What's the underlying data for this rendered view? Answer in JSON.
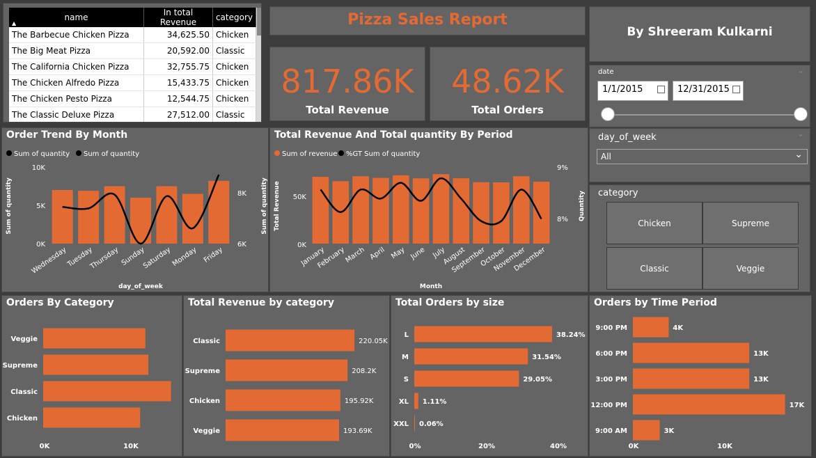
{
  "table": {
    "headers": [
      "name",
      "In total Revenue",
      "category"
    ],
    "rows": [
      [
        "The Barbecue Chicken Pizza",
        "34,625.50",
        "Chicken"
      ],
      [
        "The Big Meat Pizza",
        "20,592.00",
        "Classic"
      ],
      [
        "The California Chicken Pizza",
        "32,755.75",
        "Chicken"
      ],
      [
        "The Chicken Alfredo Pizza",
        "15,433.75",
        "Chicken"
      ],
      [
        "The Chicken Pesto Pizza",
        "12,544.75",
        "Chicken"
      ],
      [
        "The Classic Deluxe Pizza",
        "27,512.00",
        "Classic"
      ]
    ]
  },
  "report_title": "Pizza Sales Report",
  "author": "By Shreeram Kulkarni",
  "kpis": {
    "revenue_value": "817.86K",
    "revenue_label": "Total Revenue",
    "orders_value": "48.62K",
    "orders_label": "Total Orders"
  },
  "date_filter": {
    "label": "date",
    "start": "1/1/2015",
    "end": "12/31/2015"
  },
  "dow_filter": {
    "label": "day_of_week",
    "value": "All"
  },
  "category_filter": {
    "label": "category",
    "options": [
      "Chicken",
      "Supreme",
      "Classic",
      "Veggie"
    ]
  },
  "colors": {
    "bar": "#e46a33",
    "panel": "#646464",
    "title": "#e46a33"
  },
  "chart_data": [
    {
      "type": "bar",
      "title": "Order Trend By Month",
      "legend": [
        "Sum of quantity",
        "Sum of quantity"
      ],
      "xlabel": "day_of_week",
      "ylabel": "Sum of quantity",
      "y2label": "Sum of quantity",
      "categories": [
        "Wednesday",
        "Tuesday",
        "Thursday",
        "Sunday",
        "Saturday",
        "Monday",
        "Friday"
      ],
      "values": [
        7000,
        6900,
        7500,
        6000,
        7500,
        6500,
        8200
      ],
      "line_values": [
        7200,
        7150,
        7600,
        6000,
        7550,
        6500,
        8250
      ],
      "yticks": [
        "10K",
        "5K",
        "0K"
      ],
      "y2ticks": [
        "8K",
        "6K"
      ],
      "ylim": [
        0,
        10000
      ],
      "y2lim": [
        6000,
        8500
      ]
    },
    {
      "type": "bar",
      "title": "Total Revenue And Total quantity By Period",
      "legend": [
        "Sum of revenue",
        "%GT Sum of quantity"
      ],
      "xlabel": "Month",
      "ylabel": "Total Revenue",
      "y2label": "Quantity",
      "categories": [
        "January",
        "February",
        "March",
        "April",
        "May",
        "June",
        "July",
        "August",
        "September",
        "October",
        "November",
        "December"
      ],
      "values": [
        69800,
        65200,
        70400,
        68700,
        71400,
        68200,
        72600,
        68300,
        64200,
        64000,
        70400,
        64700
      ],
      "line_values": [
        8.6,
        8.1,
        8.6,
        8.4,
        8.75,
        8.35,
        8.85,
        8.4,
        7.9,
        7.9,
        8.6,
        7.95
      ],
      "yticks": [
        "50K",
        "0K"
      ],
      "y2ticks": [
        "9%",
        "8%"
      ],
      "ylim": [
        0,
        80000
      ],
      "y2lim": [
        7.4,
        9.1
      ]
    },
    {
      "type": "bar",
      "title": "Orders By Category",
      "categories": [
        "Veggie",
        "Supreme",
        "Classic",
        "Chicken"
      ],
      "values": [
        11650,
        11990,
        14580,
        11050
      ],
      "xticks": [
        "0K",
        "10K"
      ],
      "xlim": [
        0,
        15000
      ]
    },
    {
      "type": "bar",
      "title": "Total Revenue by category",
      "categories": [
        "Classic",
        "Supreme",
        "Chicken",
        "Veggie"
      ],
      "values": [
        220050,
        208200,
        195920,
        193690
      ],
      "labels": [
        "220.05K",
        "208.2K",
        "195.92K",
        "193.69K"
      ]
    },
    {
      "type": "bar",
      "title": "Total Orders by size",
      "categories": [
        "L",
        "M",
        "S",
        "XL",
        "XXL"
      ],
      "values": [
        38.24,
        31.54,
        29.05,
        1.11,
        0.06
      ],
      "labels": [
        "38.24%",
        "31.54%",
        "29.05%",
        "1.11%",
        "0.06%"
      ],
      "xticks": [
        "0%",
        "20%",
        "40%"
      ],
      "xlim": [
        0,
        40
      ]
    },
    {
      "type": "bar",
      "title": "Orders by Time Period",
      "categories": [
        "9:00 PM",
        "6:00 PM",
        "3:00 PM",
        "12:00 PM",
        "9:00 AM"
      ],
      "values": [
        4000,
        13000,
        13000,
        17000,
        3000
      ],
      "labels": [
        "4K",
        "13K",
        "13K",
        "17K",
        "3K"
      ],
      "xticks": [
        "0K",
        "10K"
      ],
      "xlim": [
        0,
        17500
      ]
    }
  ]
}
